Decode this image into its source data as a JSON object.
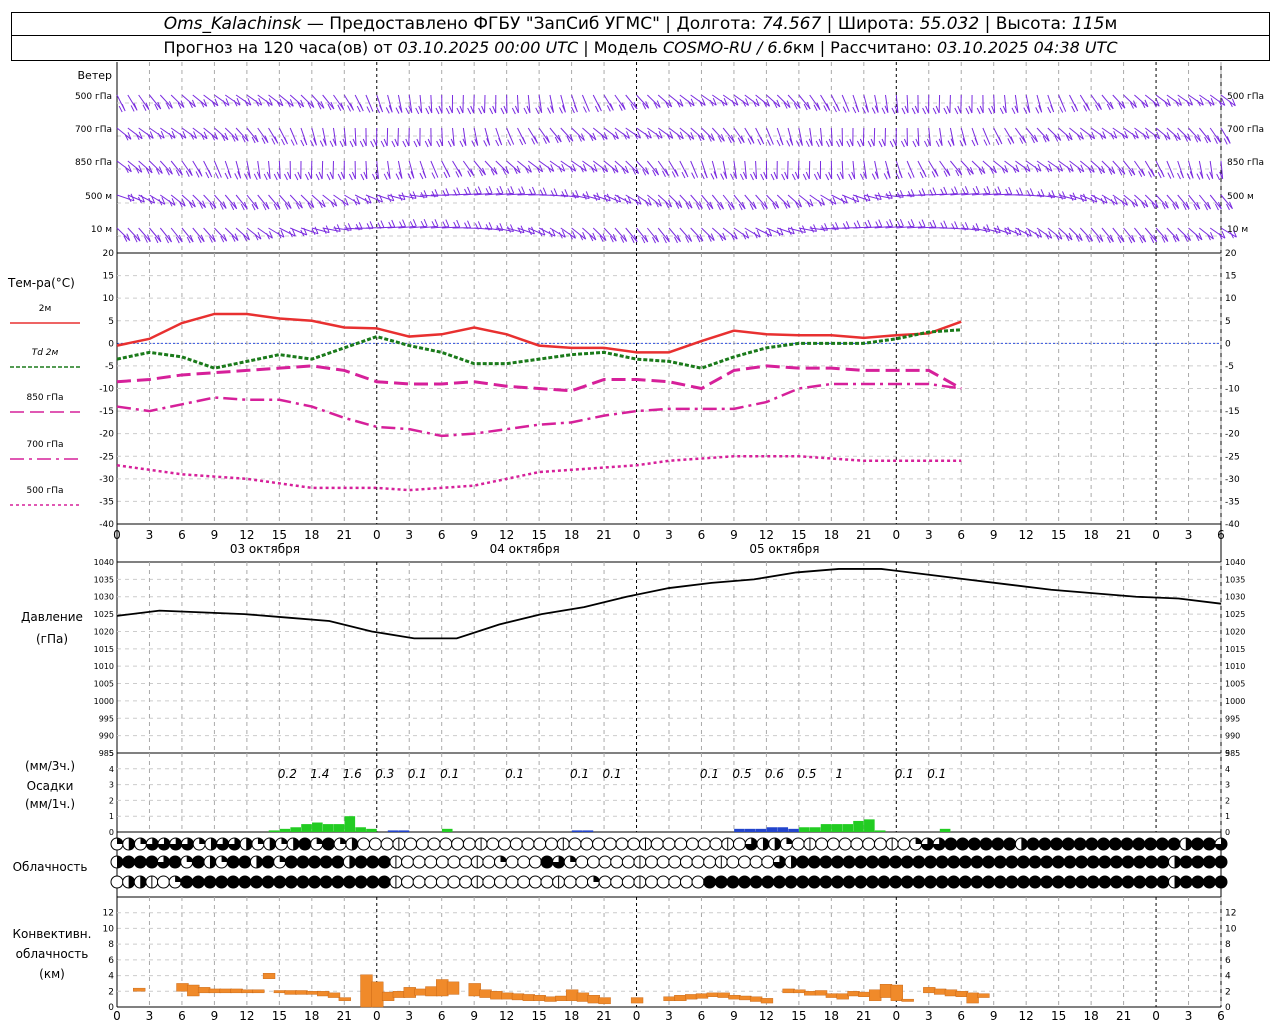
{
  "header": {
    "station": "Oms_Kalachinsk",
    "provider": "— Предоставлено ФГБУ \"ЗапСиб УГМС\"",
    "lon_label": "Долгота:",
    "lon": "74.567",
    "lat_label": "Широта:",
    "lat": "55.032",
    "alt_label": "Высота:",
    "alt": "115",
    "alt_unit": "м",
    "forecast_label": "Прогноз на 120 часа(ов) от",
    "forecast_start": "03.10.2025 00:00 UTC",
    "model_label": "Модель",
    "model": "COSMO-RU / 6.6",
    "model_unit": "км",
    "calc_label": "Рассчитано:",
    "calc_time": "03.10.2025 04:38 UTC"
  },
  "chart_data": [
    {
      "type": "wind_barbs",
      "panel_title": "Ветер",
      "levels": [
        "500 гПа",
        "700 гПа",
        "850 гПа",
        "500 м",
        "10 м"
      ]
    },
    {
      "type": "line",
      "ylabel": "Тем-ра(°C)",
      "ylim": [
        -40,
        20
      ],
      "yticks": [
        -40,
        -35,
        -30,
        -25,
        -20,
        -15,
        -10,
        -5,
        0,
        5,
        10,
        15,
        20
      ],
      "x_hours": [
        0,
        3,
        6,
        9,
        12,
        15,
        18,
        21,
        24,
        27,
        30,
        33,
        36,
        39,
        42,
        45,
        48,
        51,
        54,
        57,
        60,
        63,
        66,
        69,
        72,
        75,
        78,
        81,
        84,
        87,
        90,
        93,
        96,
        99,
        102
      ],
      "x_tick_labels": [
        "0",
        "3",
        "6",
        "9",
        "12",
        "15",
        "18",
        "21",
        "0",
        "3",
        "6",
        "9",
        "12",
        "15",
        "18",
        "21",
        "0",
        "3",
        "6",
        "9",
        "12",
        "15",
        "18",
        "21",
        "0",
        "3",
        "6",
        "9",
        "12",
        "15",
        "18",
        "21",
        "0",
        "3",
        "6"
      ],
      "dates": [
        "03 октября",
        "04 октября",
        "05 октября"
      ],
      "series": [
        {
          "name": "2м",
          "color": "#e83030",
          "values": [
            -0.5,
            1,
            4.5,
            6.5,
            6.5,
            5.5,
            5,
            3.5,
            3.3,
            1.5,
            2,
            3.5,
            2,
            -0.5,
            -1,
            -1,
            -2,
            -2,
            0.5,
            2.8,
            2,
            1.8,
            1.8,
            1.2,
            1.8,
            2.2,
            4.8,
            0,
            0,
            0,
            0,
            0,
            0,
            0,
            0
          ]
        },
        {
          "name": "Td 2м",
          "color": "#1a7a1a",
          "values": [
            -3.5,
            -2,
            -3,
            -5.5,
            -4,
            -2.5,
            -3.5,
            -1,
            1.5,
            -0.5,
            -2,
            -4.5,
            -4.5,
            -3.5,
            -2.5,
            -2,
            -3.5,
            -4,
            -5.5,
            -3,
            -1,
            0,
            0,
            0,
            1,
            2.5,
            3,
            0,
            0,
            0,
            0,
            0,
            0,
            0,
            0
          ]
        },
        {
          "name": "850 гПа",
          "color": "#d6209a",
          "values": [
            -8.5,
            -8,
            -7,
            -6.5,
            -6,
            -5.5,
            -5,
            -6,
            -8.5,
            -9,
            -9,
            -8.5,
            -9.5,
            -10,
            -10.5,
            -8,
            -8,
            -8.5,
            -10,
            -6,
            -5,
            -5.5,
            -5.5,
            -6,
            -6,
            -6,
            -10,
            0,
            0,
            0,
            0,
            0,
            0,
            0,
            0
          ]
        },
        {
          "name": "700 гПа",
          "color": "#d6209a",
          "values": [
            -14,
            -15,
            -13.5,
            -12,
            -12.5,
            -12.5,
            -14,
            -16.5,
            -18.5,
            -19,
            -20.5,
            -20,
            -19,
            -18,
            -17.5,
            -16,
            -15,
            -14.5,
            -14.5,
            -14.5,
            -13,
            -10,
            -9,
            -9,
            -9,
            -9,
            -10,
            0,
            0,
            0,
            0,
            0,
            0,
            0,
            0
          ]
        },
        {
          "name": "500 гПа",
          "color": "#d6209a",
          "values": [
            -27,
            -28,
            -29,
            -29.5,
            -30,
            -31,
            -32,
            -32,
            -32,
            -32.5,
            -32,
            -31.5,
            -30,
            -28.5,
            -28,
            -27.5,
            -27,
            -26,
            -25.5,
            -25,
            -25,
            -25,
            -25.5,
            -26,
            -26,
            -26,
            -26,
            0,
            0,
            0,
            0,
            0,
            0,
            0,
            0
          ]
        }
      ]
    },
    {
      "type": "line",
      "ylabel": "Давление",
      "yunit": "(гПа)",
      "ylim": [
        985,
        1040
      ],
      "yticks": [
        985,
        990,
        995,
        1000,
        1005,
        1010,
        1015,
        1020,
        1025,
        1030,
        1035,
        1040
      ],
      "values": [
        1024.5,
        1026,
        1025.5,
        1025,
        1024,
        1023,
        1020,
        1018,
        1018,
        1022,
        1025,
        1027,
        1030,
        1032.5,
        1034,
        1035,
        1037,
        1038,
        1038,
        1036.5,
        1035,
        1033.5,
        1032,
        1031,
        1030,
        1029.5,
        1028
      ]
    },
    {
      "type": "bar",
      "ylabel": "Осадки",
      "yunit_top": "(мм/3ч.)",
      "yunit_bottom": "(мм/1ч.)",
      "ylim": [
        0,
        5
      ],
      "labels": [
        {
          "h": 15,
          "t": "0.2"
        },
        {
          "h": 18,
          "t": "1.4"
        },
        {
          "h": 21,
          "t": "1.6"
        },
        {
          "h": 24,
          "t": "0.3"
        },
        {
          "h": 27,
          "t": "0.1"
        },
        {
          "h": 30,
          "t": "0.1"
        },
        {
          "h": 36,
          "t": "0.1"
        },
        {
          "h": 42,
          "t": "0.1"
        },
        {
          "h": 45,
          "t": "0.1"
        },
        {
          "h": 54,
          "t": "0.1"
        },
        {
          "h": 57,
          "t": "0.5"
        },
        {
          "h": 60,
          "t": "0.6"
        },
        {
          "h": 63,
          "t": "0.5"
        },
        {
          "h": 66,
          "t": "1"
        },
        {
          "h": 72,
          "t": "0.1"
        },
        {
          "h": 75,
          "t": "0.1"
        }
      ],
      "green_bars": [
        [
          15,
          0.1
        ],
        [
          16,
          0.2
        ],
        [
          17,
          0.3
        ],
        [
          18,
          0.5
        ],
        [
          19,
          0.6
        ],
        [
          20,
          0.5
        ],
        [
          21,
          0.5
        ],
        [
          22,
          1.0
        ],
        [
          23,
          0.3
        ],
        [
          24,
          0.2
        ],
        [
          31,
          0.2
        ],
        [
          64,
          0.3
        ],
        [
          65,
          0.3
        ],
        [
          66,
          0.5
        ],
        [
          67,
          0.5
        ],
        [
          68,
          0.5
        ],
        [
          69,
          0.7
        ],
        [
          70,
          0.8
        ],
        [
          71,
          0.1
        ],
        [
          77,
          0.2
        ]
      ],
      "blue_bars": [
        [
          26,
          0.1
        ],
        [
          27,
          0.1
        ],
        [
          43,
          0.1
        ],
        [
          44,
          0.1
        ],
        [
          58,
          0.2
        ],
        [
          59,
          0.2
        ],
        [
          60,
          0.2
        ],
        [
          61,
          0.3
        ],
        [
          62,
          0.3
        ],
        [
          63,
          0.2
        ]
      ]
    },
    {
      "type": "symbols",
      "ylabel": "Облачность",
      "rows": [
        "QHQTTTTQHTTHQHQHFQFQHOOOOOOOOOOOOOOOOOOOOOOOOOOOOOOOOOTHHQOOOOOOOOOOQTTFFFFFFHFFFFFFFFFFFFFHFFT",
        "HFFFTFQFHQFFHFQFFFFFHFFFOOOOOOOOOQOOOFTQOOOOOOOOOOOOOOOOOTHFFFFFFFFFFFFFFFFFFFFFFFFFFFFFFFFHFFFF",
        "OHHOOQFFFFFFFFFFFFFFFFFFOOOOOOOOOOOOOOOOOQOOOOOOOOOFFFFFFFFFFFFFFFFFFFFFFFFFFFFFFFFFFFFFFFFHFFFF"
      ]
    },
    {
      "type": "bar",
      "ylabel": "Конвективн. облачность",
      "yunit": "(км)",
      "ylim": [
        0,
        14
      ],
      "yticks": [
        0,
        2,
        4,
        6,
        8,
        10,
        12
      ],
      "bars": [
        [
          2,
          2,
          2.4
        ],
        [
          6,
          2,
          3
        ],
        [
          7,
          1.4,
          2.8
        ],
        [
          8,
          1.8,
          2.5
        ],
        [
          9,
          1.8,
          2.3
        ],
        [
          10,
          1.8,
          2.3
        ],
        [
          11,
          1.8,
          2.3
        ],
        [
          12,
          1.8,
          2.2
        ],
        [
          13,
          1.8,
          2.2
        ],
        [
          14,
          3.6,
          4.3
        ],
        [
          15,
          1.8,
          2.1
        ],
        [
          16,
          1.6,
          2.1
        ],
        [
          17,
          1.6,
          2.1
        ],
        [
          18,
          1.6,
          2.0
        ],
        [
          19,
          1.4,
          2.0
        ],
        [
          20,
          1.2,
          1.8
        ],
        [
          21,
          0.8,
          1.2
        ],
        [
          23,
          0,
          4.1
        ],
        [
          24,
          0,
          3.2
        ],
        [
          25,
          0.8,
          1.9
        ],
        [
          26,
          1.2,
          2.0
        ],
        [
          27,
          1.2,
          2.5
        ],
        [
          28,
          1.5,
          2.3
        ],
        [
          29,
          1.4,
          2.6
        ],
        [
          30,
          1.4,
          3.5
        ],
        [
          31,
          1.6,
          3.2
        ],
        [
          33,
          1.4,
          3.0
        ],
        [
          34,
          1.2,
          2.2
        ],
        [
          35,
          1.0,
          2.0
        ],
        [
          36,
          1.0,
          1.8
        ],
        [
          37,
          0.9,
          1.7
        ],
        [
          38,
          0.8,
          1.6
        ],
        [
          39,
          0.8,
          1.5
        ],
        [
          40,
          0.7,
          1.3
        ],
        [
          41,
          0.8,
          1.4
        ],
        [
          42,
          0.8,
          2.2
        ],
        [
          43,
          0.7,
          1.8
        ],
        [
          44,
          0.5,
          1.5
        ],
        [
          45,
          0.4,
          1.2
        ],
        [
          48,
          0.5,
          1.2
        ],
        [
          51,
          0.8,
          1.3
        ],
        [
          52,
          0.8,
          1.5
        ],
        [
          53,
          1.0,
          1.6
        ],
        [
          54,
          1.1,
          1.7
        ],
        [
          55,
          1.3,
          1.8
        ],
        [
          56,
          1.2,
          1.8
        ],
        [
          57,
          1.0,
          1.5
        ],
        [
          58,
          0.9,
          1.4
        ],
        [
          59,
          0.7,
          1.3
        ],
        [
          60,
          0.5,
          1.1
        ],
        [
          62,
          1.8,
          2.3
        ],
        [
          63,
          1.8,
          2.2
        ],
        [
          64,
          1.5,
          2.0
        ],
        [
          65,
          1.5,
          2.1
        ],
        [
          66,
          1.2,
          1.7
        ],
        [
          67,
          1.0,
          1.7
        ],
        [
          68,
          1.4,
          2.0
        ],
        [
          69,
          1.3,
          1.9
        ],
        [
          70,
          0.8,
          2.2
        ],
        [
          71,
          1.2,
          2.9
        ],
        [
          72,
          0.8,
          2.8
        ],
        [
          73,
          0.7,
          1.0
        ],
        [
          75,
          1.8,
          2.5
        ],
        [
          76,
          1.6,
          2.3
        ],
        [
          77,
          1.4,
          2.2
        ],
        [
          78,
          1.3,
          2.0
        ],
        [
          79,
          0.5,
          1.8
        ],
        [
          80,
          1.2,
          1.7
        ]
      ]
    }
  ]
}
